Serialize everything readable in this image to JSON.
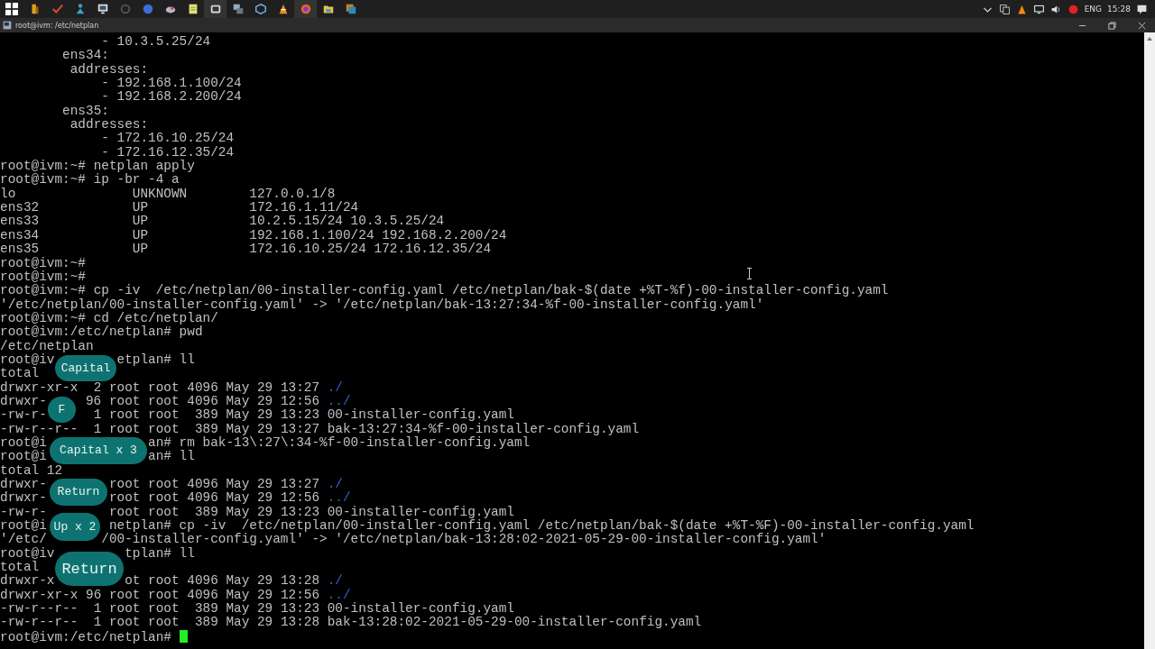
{
  "taskbar": {
    "language": "ENG",
    "time": "15:28"
  },
  "window": {
    "title": "root@ivm: /etc/netplan"
  },
  "terminal": {
    "lines": [
      {
        "parts": [
          "             - 10.3.5.25/24"
        ]
      },
      {
        "parts": [
          "        ens34:"
        ]
      },
      {
        "parts": [
          "         addresses:"
        ]
      },
      {
        "parts": [
          "             - 192.168.1.100/24"
        ]
      },
      {
        "parts": [
          "             - 192.168.2.200/24"
        ]
      },
      {
        "parts": [
          "        ens35:"
        ]
      },
      {
        "parts": [
          "         addresses:"
        ]
      },
      {
        "parts": [
          "             - 172.16.10.25/24"
        ]
      },
      {
        "parts": [
          "             - 172.16.12.35/24"
        ]
      },
      {
        "parts": [
          "root@ivm:~# netplan apply"
        ]
      },
      {
        "parts": [
          "root@ivm:~# ip -br -4 a"
        ]
      },
      {
        "parts": [
          "lo               UNKNOWN        127.0.0.1/8"
        ]
      },
      {
        "parts": [
          "ens32            UP             172.16.1.11/24"
        ]
      },
      {
        "parts": [
          "ens33            UP             10.2.5.15/24 10.3.5.25/24"
        ]
      },
      {
        "parts": [
          "ens34            UP             192.168.1.100/24 192.168.2.200/24"
        ]
      },
      {
        "parts": [
          "ens35            UP             172.16.10.25/24 172.16.12.35/24"
        ]
      },
      {
        "parts": [
          "root@ivm:~#"
        ]
      },
      {
        "parts": [
          "root@ivm:~#"
        ]
      },
      {
        "parts": [
          "root@ivm:~# cp -iv  /etc/netplan/00-installer-config.yaml /etc/netplan/bak-$(date +%T-%f)-00-installer-config.yaml"
        ]
      },
      {
        "parts": [
          "'/etc/netplan/00-installer-config.yaml' -> '/etc/netplan/bak-13:27:34-%f-00-installer-config.yaml'"
        ]
      },
      {
        "parts": [
          "root@ivm:~# cd /etc/netplan/"
        ]
      },
      {
        "parts": [
          "root@ivm:/etc/netplan# pwd"
        ]
      },
      {
        "parts": [
          "/etc/netplan"
        ]
      },
      {
        "parts": [
          "root@iv",
          "etplan# ll"
        ]
      },
      {
        "parts": [
          "total"
        ]
      },
      {
        "parts": [
          "drwxr-xr-x  2 root root 4096 May 29 13:27 "
        ],
        "dir": "./"
      },
      {
        "parts": [
          "drwxr-",
          "96 root root 4096 May 29 12:56 "
        ],
        "dir": "../"
      },
      {
        "parts": [
          "-rw-r-",
          "1 root root  389 May 29 13:23 00-installer-config.yaml"
        ]
      },
      {
        "parts": [
          "-rw-r--r--  1 root root  389 May 29 13:27 bak-13:27:34-%f-00-installer-config.yaml"
        ]
      },
      {
        "parts": [
          "root@i",
          "an# rm bak-13\\:27\\:34-%f-00-installer-config.yaml"
        ]
      },
      {
        "parts": [
          "root@i",
          "an# ll"
        ]
      },
      {
        "parts": [
          "total 12"
        ]
      },
      {
        "parts": [
          "drwxr-",
          "root root 4096 May 29 13:27 "
        ],
        "dir": "./"
      },
      {
        "parts": [
          "drwxr-",
          "root root 4096 May 29 12:56 "
        ],
        "dir": "../"
      },
      {
        "parts": [
          "-rw-r-",
          "root root  389 May 29 13:23 00-installer-config.yaml"
        ]
      },
      {
        "parts": [
          "root@i",
          "netplan# cp -iv  /etc/netplan/00-installer-config.yaml /etc/netplan/bak-$(date +%T-%F)-00-installer-config.yaml"
        ]
      },
      {
        "parts": [
          "'/etc/",
          "/00-installer-config.yaml' -> '/etc/netplan/bak-13:28:02-2021-05-29-00-installer-config.yaml'"
        ]
      },
      {
        "parts": [
          "root@iv",
          "tplan# ll"
        ]
      },
      {
        "parts": [
          "total"
        ]
      },
      {
        "parts": [
          "drwxr-x",
          "ot root 4096 May 29 13:28 "
        ],
        "dir": "./"
      },
      {
        "parts": [
          "drwxr-xr-x 96 root root 4096 May 29 12:56 "
        ],
        "dir": "../"
      },
      {
        "parts": [
          "-rw-r--r--  1 root root  389 May 29 13:23 00-installer-config.yaml"
        ]
      },
      {
        "parts": [
          "-rw-r--r--  1 root root  389 May 29 13:28 bak-13:28:02-2021-05-29-00-installer-config.yaml"
        ]
      },
      {
        "parts": [
          "root@ivm:/etc/netplan# "
        ],
        "cursor": true
      }
    ]
  },
  "keystrokes": [
    {
      "label": "Capital"
    },
    {
      "label": "F"
    },
    {
      "label": "Capital x 3"
    },
    {
      "label": "Return"
    },
    {
      "label": "Up x 2"
    },
    {
      "label": "Return",
      "kind": "latest"
    }
  ]
}
